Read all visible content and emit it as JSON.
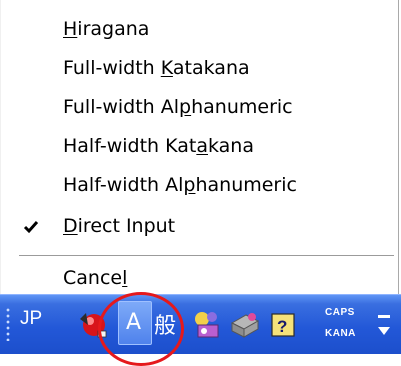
{
  "menu": {
    "items": [
      {
        "pre": "",
        "key": "H",
        "post": "iragana",
        "checked": false
      },
      {
        "pre": "Full-width ",
        "key": "K",
        "post": "atakana",
        "checked": false
      },
      {
        "pre": "Full-width Al",
        "key": "p",
        "post": "hanumeric",
        "checked": false
      },
      {
        "pre": "Half-width Kat",
        "key": "a",
        "post": "kana",
        "checked": false
      },
      {
        "pre": "Half-width Al",
        "key": "p",
        "post": "hanumeric",
        "checked": false
      },
      {
        "pre": "",
        "key": "D",
        "post": "irect Input",
        "checked": true
      }
    ],
    "cancel": {
      "pre": "Cance",
      "key": "l",
      "post": ""
    }
  },
  "taskbar": {
    "language": "JP",
    "input_mode": "A",
    "caps_label": "CAPS",
    "kana_label": "KANA"
  },
  "icons": {
    "input_method": "ime-red-ball-icon",
    "mode": "input-mode-a-icon",
    "dictionary": "dictionary-kanji-icon",
    "pad": "ime-pad-icon",
    "tools": "tools-icon",
    "help": "help-icon",
    "options": "options-arrow-icon"
  },
  "colors": {
    "taskbar": "#2358d8",
    "highlight_circle": "#e5191c"
  }
}
